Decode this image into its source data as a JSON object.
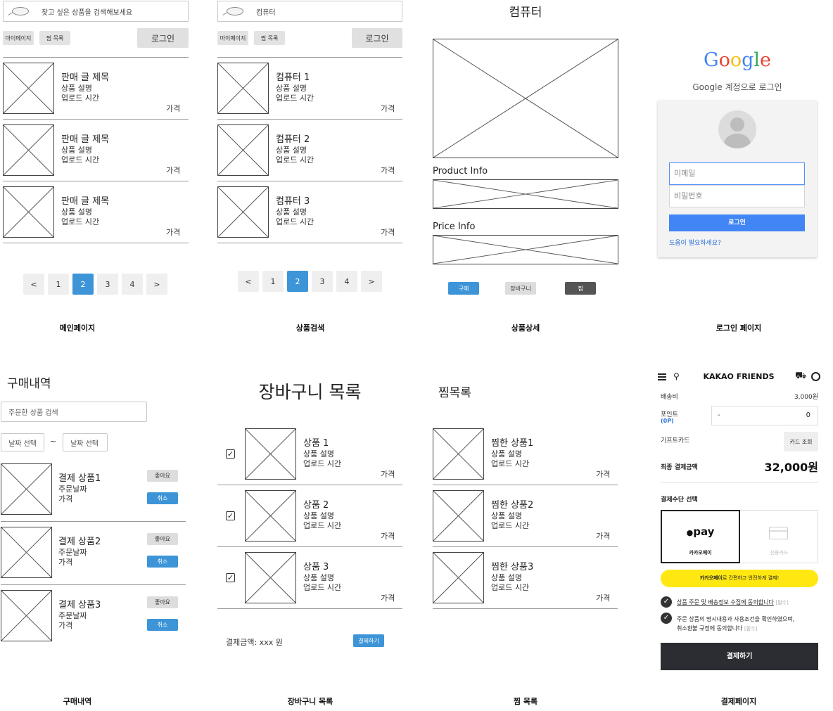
{
  "main": {
    "search_placeholder": "찾고 싶은 상품을 검색해보세요",
    "mypage": "마이페이지",
    "wishlist": "찜 목록",
    "login": "로그인",
    "items": [
      {
        "title": "판매 글 제목",
        "desc": "상품 설명",
        "time": "업로드 시간",
        "price": "가격"
      },
      {
        "title": "판매 글 제목",
        "desc": "상품 설명",
        "time": "업로드 시간",
        "price": "가격"
      },
      {
        "title": "판매 글 제목",
        "desc": "상품 설명",
        "time": "업로드 시간",
        "price": "가격"
      }
    ],
    "pagination": [
      "<",
      "1",
      "2",
      "3",
      "4",
      ">"
    ],
    "active_page": "2",
    "caption": "메인페이지"
  },
  "search": {
    "query": "컴퓨터",
    "mypage": "마이페이지",
    "wishlist": "찜 목록",
    "login": "로그인",
    "items": [
      {
        "title": "컴퓨터 1",
        "desc": "상품 설명",
        "time": "업로드 시간",
        "price": "가격"
      },
      {
        "title": "컴퓨터 2",
        "desc": "상품 설명",
        "time": "업로드 시간",
        "price": "가격"
      },
      {
        "title": "컴퓨터 3",
        "desc": "상품 설명",
        "time": "업로드 시간",
        "price": "가격"
      }
    ],
    "pagination": [
      "<",
      "1",
      "2",
      "3",
      "4",
      ">"
    ],
    "caption": "상품검색"
  },
  "detail": {
    "title": "컴퓨터",
    "product_info": "Product Info",
    "price_info": "Price Info",
    "buy": "구매",
    "cart": "장바구니",
    "wish": "찜",
    "caption": "상품상세"
  },
  "login_page": {
    "logo": [
      "G",
      "o",
      "o",
      "g",
      "l",
      "e"
    ],
    "logo_colors": [
      "#4285f4",
      "#ea4335",
      "#fbbc05",
      "#4285f4",
      "#34a853",
      "#ea4335"
    ],
    "subtitle": "Google 계정으로 로그인",
    "email_placeholder": "이메일",
    "password_placeholder": "비밀번호",
    "login_button": "로그인",
    "help": "도움이 필요하세요?",
    "caption": "로그인 페이지"
  },
  "orders": {
    "title": "구매내역",
    "search_placeholder": "주문한 상품 검색",
    "date_from": "날짜 선택",
    "tilde": "~",
    "date_to": "날짜 선택",
    "items": [
      {
        "title": "결제 상품1",
        "date": "주문날짜",
        "price": "가격",
        "like": "좋아요",
        "cancel": "취소"
      },
      {
        "title": "결제 상품2",
        "date": "주문날짜",
        "price": "가격",
        "like": "좋아요",
        "cancel": "취소"
      },
      {
        "title": "결제 상품3",
        "date": "주문날짜",
        "price": "가격",
        "like": "좋아요",
        "cancel": "취소"
      }
    ],
    "caption": "구매내역"
  },
  "cart": {
    "title": "장바구니 목록",
    "items": [
      {
        "checked": "✓",
        "title": "상품 1",
        "desc": "상품 설명",
        "time": "업로드 시간",
        "price": "가격"
      },
      {
        "checked": "✓",
        "title": "상품 2",
        "desc": "상품 설명",
        "time": "업로드 시간",
        "price": "가격"
      },
      {
        "checked": "✓",
        "title": "상품 3",
        "desc": "상품 설명",
        "time": "업로드 시간",
        "price": "가격"
      }
    ],
    "total": "결제금액: xxx 원",
    "pay_button": "결제하기",
    "caption": "장바구니 목록"
  },
  "wishlist": {
    "title": "찜목록",
    "items": [
      {
        "title": "찜한 상품1",
        "desc": "상품 설명",
        "time": "업로드 시간",
        "price": "가격"
      },
      {
        "title": "찜한 상품2",
        "desc": "상품 설명",
        "time": "업로드 시간",
        "price": "가격"
      },
      {
        "title": "찜한 상품3",
        "desc": "상품 설명",
        "time": "업로드 시간",
        "price": "가격"
      }
    ],
    "caption": "찜 목록"
  },
  "checkout": {
    "brand": "KAKAO FRIENDS",
    "shipping_label": "배송비",
    "shipping_value": "3,000원",
    "points_label": "포인트",
    "points_sub": "(0P)",
    "points_dash": "-",
    "points_value": "0",
    "giftcard_label": "기프트카드",
    "giftcard_button": "카드 조회",
    "final_label": "최종 결제금액",
    "final_value": "32,000원",
    "method_label": "결제수단 선택",
    "kakaopay_logo": "pay",
    "kakaopay_name": "카카오페이",
    "card_name": "신용카드",
    "banner_bold": "카카오페이",
    "banner_rest": "로 간편하고 안전하게 결제!",
    "agree1": "상품 주문 및 배송정보 수집에 동의합니다",
    "agree1_tag": "[필수]",
    "agree2_line1": "주문 상품의 명시내용과 사용조건을 확인하였으며,",
    "agree2_line2": "취소환불 규정에 동의합니다",
    "agree2_tag": "[필수]",
    "pay_button": "결제하기",
    "caption": "결제페이지",
    "accent": "#ffe812"
  }
}
